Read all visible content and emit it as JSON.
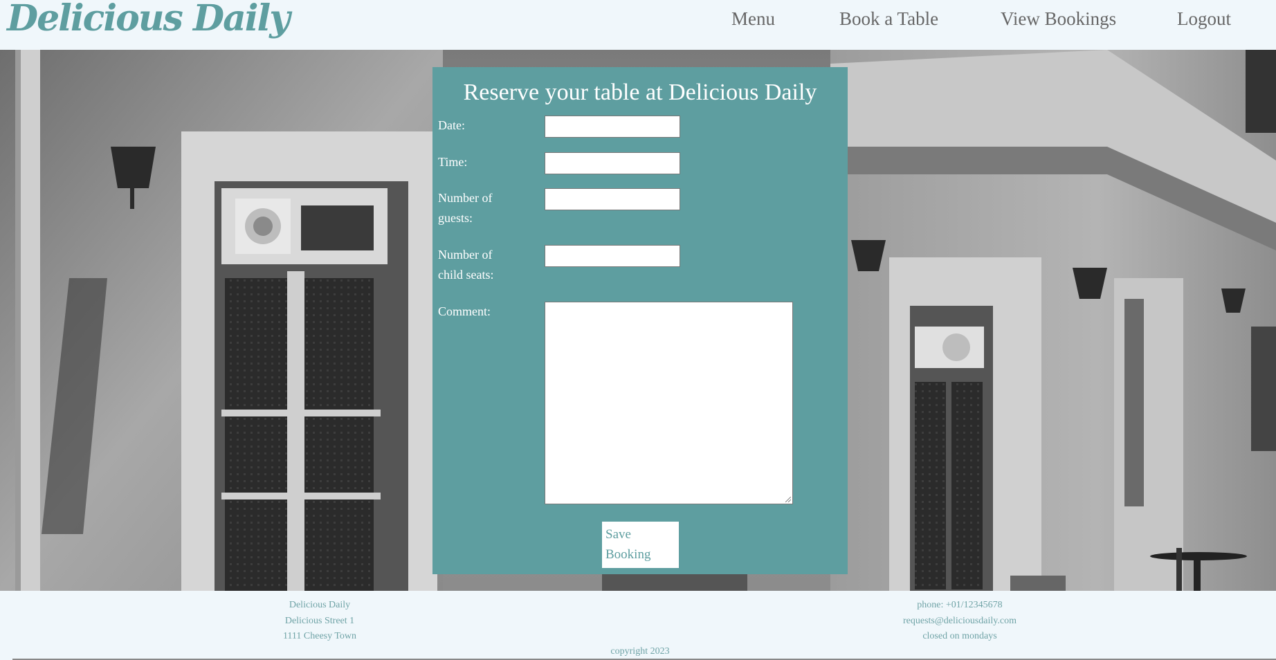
{
  "header": {
    "logo": "Delicious Daily",
    "nav": [
      {
        "label": "Menu"
      },
      {
        "label": "Book a Table"
      },
      {
        "label": "View Bookings"
      },
      {
        "label": "Logout"
      }
    ]
  },
  "form": {
    "title": "Reserve your table at Delicious Daily",
    "date_label": "Date:",
    "time_label": "Time:",
    "guests_label": "Number of guests:",
    "child_seats_label": "Number of child seats:",
    "comment_label": "Comment:",
    "date_value": "",
    "time_value": "",
    "guests_value": "",
    "child_seats_value": "",
    "comment_value": "",
    "save_label": "Save Booking"
  },
  "footer": {
    "left": [
      "Delicious Daily",
      "Delicious Street 1",
      "1111 Cheesy Town"
    ],
    "right": [
      "phone: +01/12345678",
      "requests@deliciousdaily.com",
      "closed on mondays"
    ],
    "copyright": "copyright 2023"
  },
  "colors": {
    "brand": "#5e9ea0",
    "page_bg": "#f0f7fb",
    "nav_text": "#666666",
    "footer_text": "#6fa3a6"
  }
}
